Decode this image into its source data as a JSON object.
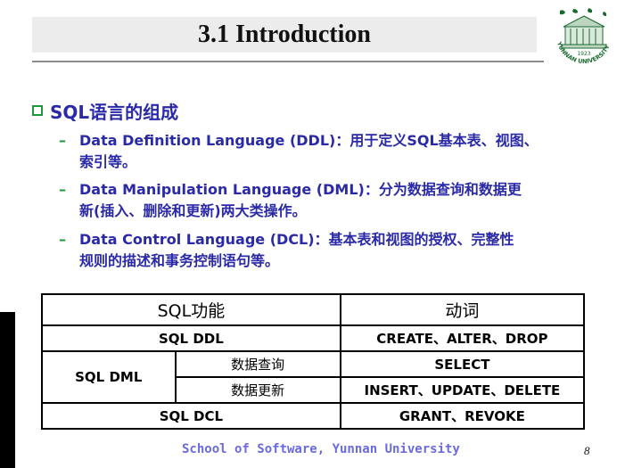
{
  "slide": {
    "title": "3.1  Introduction",
    "bullet": "SQL语言的组成",
    "items": [
      {
        "line1": "Data Definition Language (DDL)：用于定义SQL基本表、视图、",
        "line2": "索引等。"
      },
      {
        "line1": "Data Manipulation Language (DML)：分为数据查询和数据更",
        "line2": "新(插入、删除和更新)两大类操作。"
      },
      {
        "line1": "Data Control Language (DCL)：基本表和视图的授权、完整性",
        "line2": "规则的描述和事务控制语句等。"
      }
    ],
    "table": {
      "header": [
        "SQL功能",
        "动词"
      ],
      "ddl": {
        "label": "SQL DDL",
        "verbs": "CREATE、ALTER、DROP"
      },
      "dml": {
        "label": "SQL DML",
        "query": {
          "label": "数据查询",
          "verbs": "SELECT"
        },
        "update": {
          "label": "数据更新",
          "verbs": "INSERT、UPDATE、DELETE"
        }
      },
      "dcl": {
        "label": "SQL DCL",
        "verbs": "GRANT、REVOKE"
      }
    },
    "footer": "School of Software, Yunnan University",
    "page_number": "8"
  },
  "logo": {
    "year": "1923",
    "arc_text": "YUNNAN UNIVERSITY",
    "icon": "university-building-icon"
  },
  "colors": {
    "accent_text": "#2a2aa8",
    "bullet_green": "#1a9a3a",
    "footer": "#6a6ae0"
  }
}
